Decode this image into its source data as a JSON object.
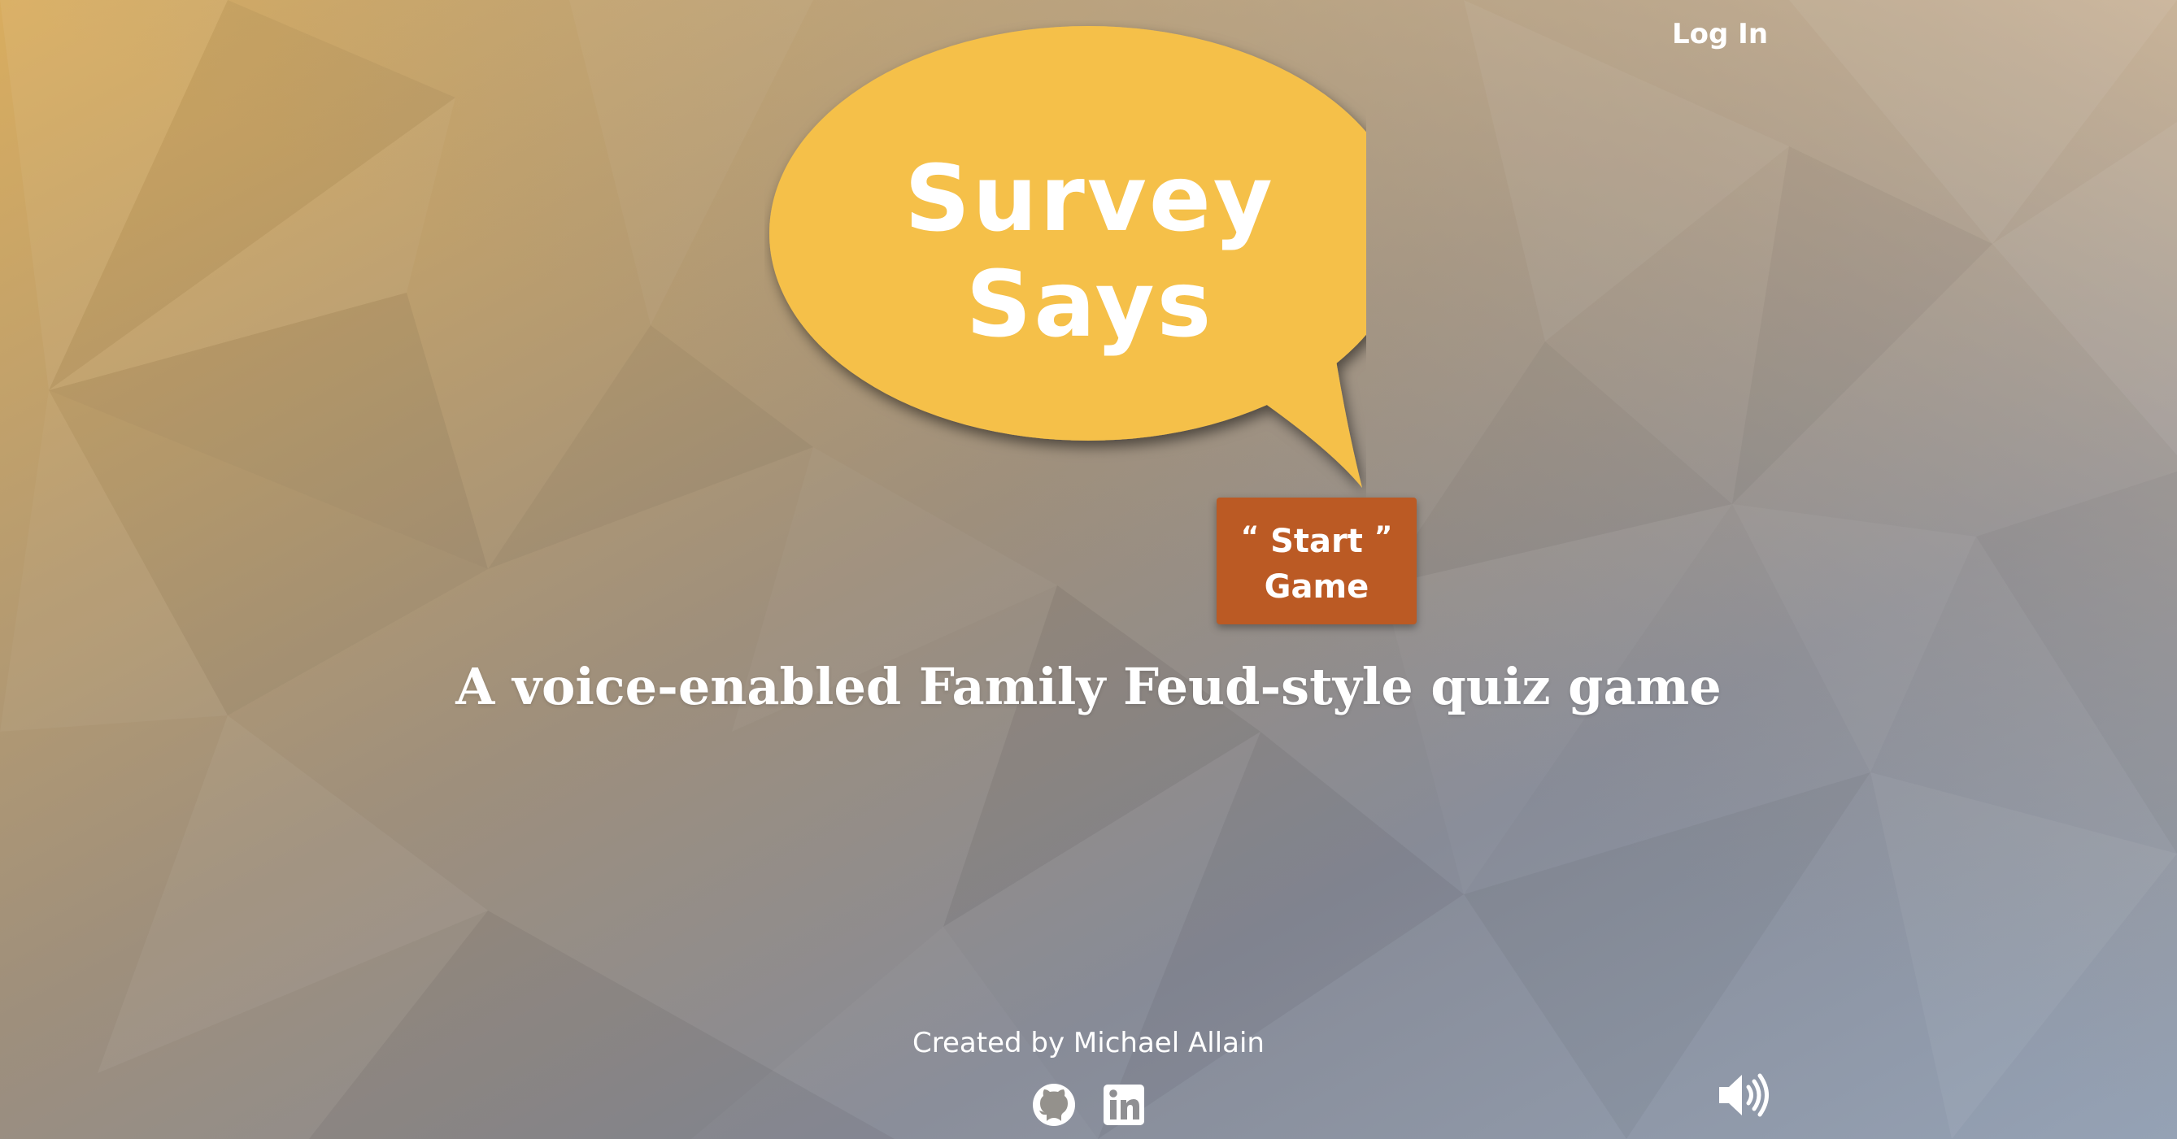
{
  "header": {
    "login_label": "Log In"
  },
  "hero": {
    "title_line1": "Survey",
    "title_line2": "Says",
    "start_button": {
      "open_quote": "“",
      "line1": "Start",
      "close_quote": "”",
      "line2": "Game"
    },
    "tagline": "A voice-enabled Family Feud-style quiz game"
  },
  "footer": {
    "credit": "Created by Michael Allain",
    "icons": [
      "github-icon",
      "linkedin-icon"
    ],
    "sound_icon": "speaker-volume-icon"
  },
  "colors": {
    "bubble": "#f5c04a",
    "start_button": "#bb5a24",
    "bg_top_left": "#d6ac5e",
    "bg_bottom_right": "#8d9bb0"
  }
}
